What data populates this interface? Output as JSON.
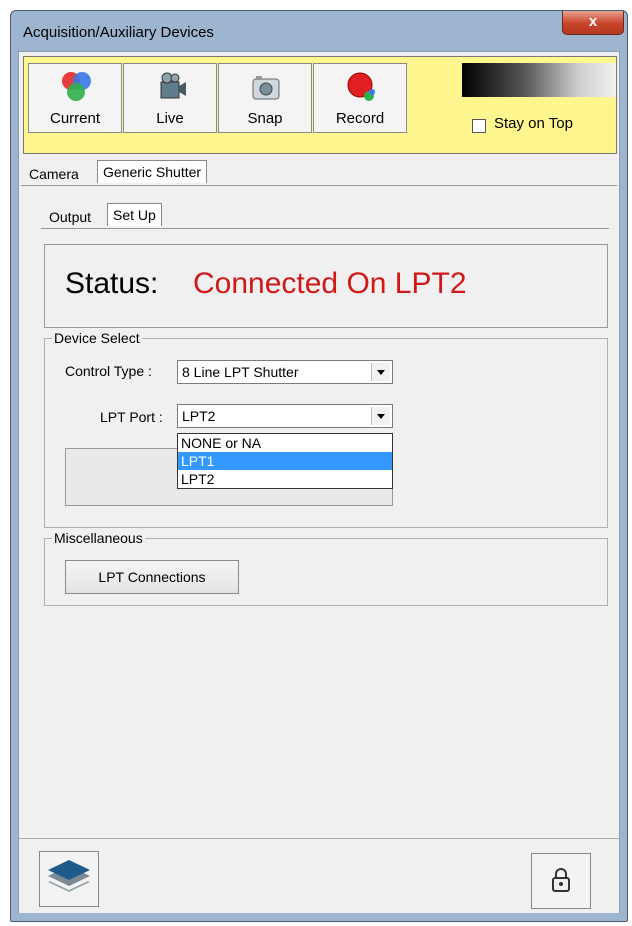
{
  "window": {
    "title": "Acquisition/Auxiliary Devices",
    "close_label": "x"
  },
  "toolbar": {
    "buttons": [
      {
        "label": "Current",
        "icon": "rgb-circles-icon"
      },
      {
        "label": "Live",
        "icon": "video-camera-icon"
      },
      {
        "label": "Snap",
        "icon": "photo-camera-icon"
      },
      {
        "label": "Record",
        "icon": "record-icon"
      }
    ],
    "stay_on_top_label": "Stay on Top",
    "stay_on_top_checked": false
  },
  "tabs_outer": [
    "Camera",
    "Generic Shutter"
  ],
  "tabs_inner": [
    "Output",
    "Set Up"
  ],
  "status": {
    "label": "Status:",
    "value": "Connected On LPT2",
    "value_color": "#d01818"
  },
  "device_select": {
    "title": "Device Select",
    "control_type_label": "Control Type :",
    "control_type_value": "8 Line LPT Shutter",
    "lpt_port_label": "LPT Port :",
    "lpt_port_value": "LPT2",
    "lpt_port_options": [
      "NONE or NA",
      "LPT1",
      "LPT2"
    ],
    "highlighted_option": "LPT1"
  },
  "misc": {
    "title": "Miscellaneous",
    "lpt_connections_label": "LPT Connections"
  },
  "bottom": {
    "left_icon": "layers-icon",
    "right_icon": "lock-icon"
  },
  "colors": {
    "toolbar_bg": "#fff68f",
    "selection": "#3399ff"
  }
}
